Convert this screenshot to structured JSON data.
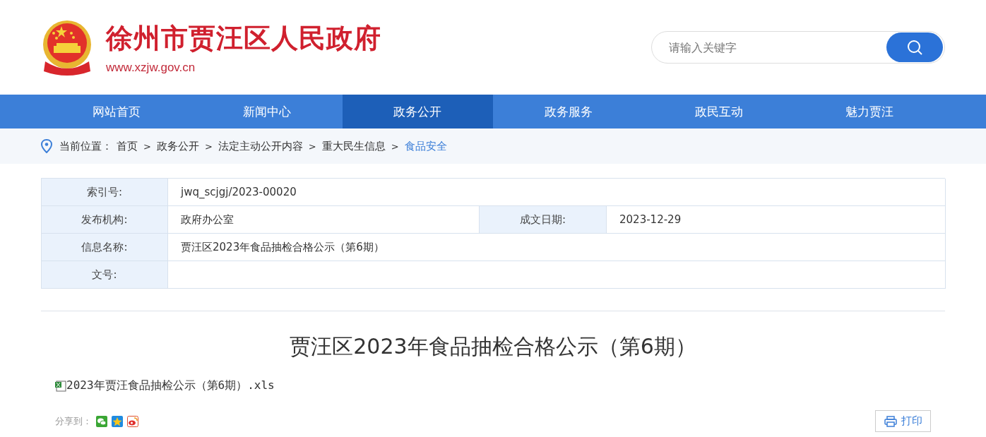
{
  "header": {
    "site_title": "徐州市贾汪区人民政府",
    "site_url": "www.xzjw.gov.cn",
    "search": {
      "placeholder": "请输入关键字"
    }
  },
  "nav": [
    {
      "label": "网站首页",
      "selected": false
    },
    {
      "label": "新闻中心",
      "selected": false
    },
    {
      "label": "政务公开",
      "selected": true
    },
    {
      "label": "政务服务",
      "selected": false
    },
    {
      "label": "政民互动",
      "selected": false
    },
    {
      "label": "魅力贾汪",
      "selected": false
    }
  ],
  "breadcrumb": {
    "label": "当前位置：",
    "items": [
      {
        "text": "首页",
        "current": false
      },
      {
        "text": "政务公开",
        "current": false
      },
      {
        "text": "法定主动公开内容",
        "current": false
      },
      {
        "text": "重大民生信息",
        "current": false
      },
      {
        "text": "食品安全",
        "current": true
      }
    ],
    "separator": ">"
  },
  "info_table": [
    {
      "cells": [
        {
          "label": "索引号:",
          "value": "jwq_scjgj/2023-00020"
        }
      ]
    },
    {
      "cells": [
        {
          "label": "发布机构:",
          "value": "政府办公室"
        },
        {
          "label": "成文日期:",
          "value": "2023-12-29"
        }
      ]
    },
    {
      "cells": [
        {
          "label": "信息名称:",
          "value": "贾汪区2023年食品抽检合格公示（第6期）"
        }
      ]
    },
    {
      "cells": [
        {
          "label": "文号:"
        }
      ]
    }
  ],
  "article": {
    "title": "贾汪区2023年食品抽检合格公示（第6期）",
    "attachment": "2023年贾汪食品抽检公示（第6期）.xls"
  },
  "share": {
    "label": "分享到：",
    "targets": [
      {
        "kind": "wechat"
      },
      {
        "kind": "qzone"
      },
      {
        "kind": "weibo"
      }
    ]
  },
  "print_button": "打印"
}
